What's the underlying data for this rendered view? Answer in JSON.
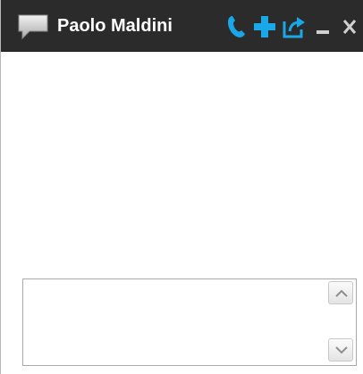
{
  "header": {
    "contact_name": "Paolo Maldini",
    "icons": {
      "chat": "chat-bubble-icon",
      "call": "phone-icon",
      "add": "plus-icon",
      "popout": "popout-icon",
      "minimize": "minimize-icon",
      "close": "close-icon"
    }
  },
  "composer": {
    "value": "",
    "placeholder": ""
  },
  "colors": {
    "titlebar": "#2b2b2b",
    "accent": "#1aa7e8",
    "title_text": "#ffffff"
  }
}
